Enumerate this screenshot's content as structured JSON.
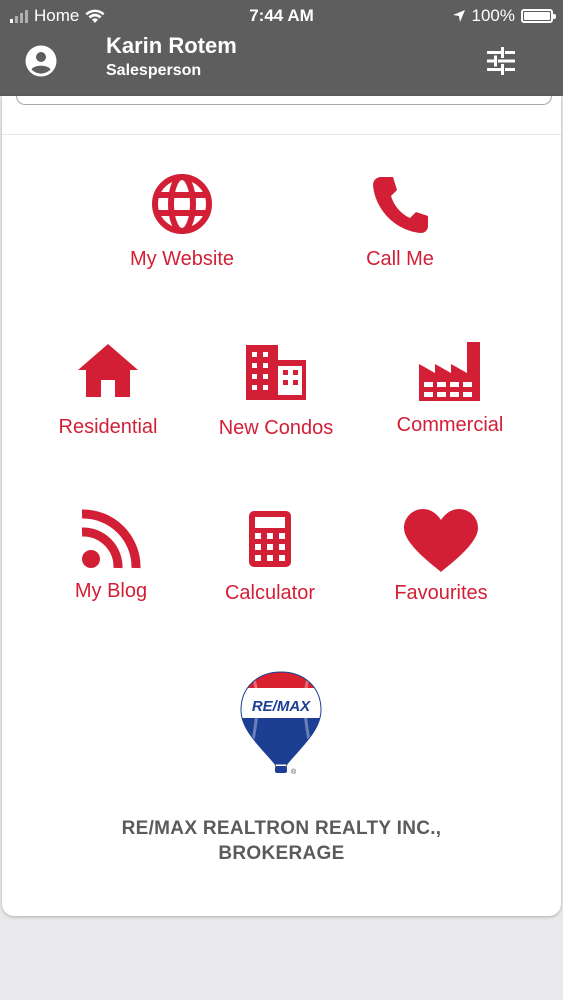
{
  "status_bar": {
    "carrier": "Home",
    "time": "7:44 AM",
    "battery": "100%"
  },
  "header": {
    "name": "Karin Rotem",
    "role": "Salesperson",
    "avatar_icon": "account-circle-icon",
    "filter_icon": "tune-sliders-icon"
  },
  "theme": {
    "accent": "#d31f36",
    "header_bg": "#5e5e5e",
    "text_gray": "#5b5b5b"
  },
  "tiles": {
    "website": {
      "label": "My Website",
      "icon": "globe-icon"
    },
    "call": {
      "label": "Call Me",
      "icon": "phone-icon"
    },
    "residential": {
      "label": "Residential",
      "icon": "house-icon"
    },
    "condos": {
      "label": "New Condos",
      "icon": "building-icon"
    },
    "commercial": {
      "label": "Commercial",
      "icon": "factory-icon"
    },
    "blog": {
      "label": "My Blog",
      "icon": "rss-icon"
    },
    "calculator": {
      "label": "Calculator",
      "icon": "calculator-icon"
    },
    "favourites": {
      "label": "Favourites",
      "icon": "heart-icon"
    }
  },
  "logo": {
    "text": "RE/MAX",
    "registered": "®"
  },
  "company": {
    "line1": "RE/MAX REALTRON REALTY INC.,",
    "line2": "BROKERAGE"
  }
}
